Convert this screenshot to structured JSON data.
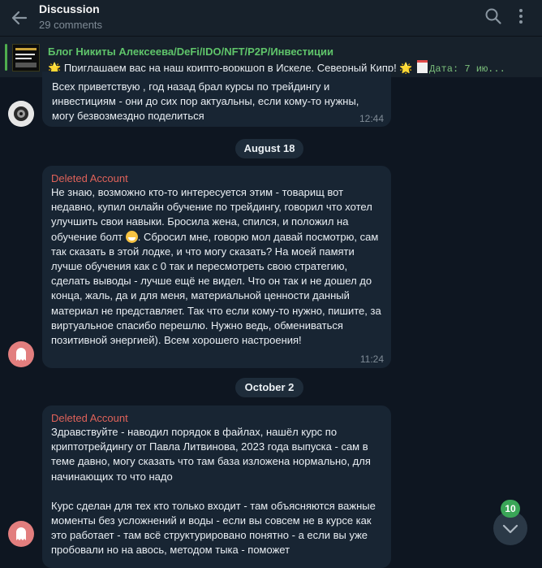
{
  "header": {
    "title": "Discussion",
    "subtitle": "29 comments"
  },
  "pinned": {
    "channel": "Блог Никиты Алексеева/DeFi/IDO/NFT/P2P/Инвестиции",
    "star_left": "🌟",
    "text": "Приглашаем вас на наш крипто-воркшоп в Искеле, Северный Кипр!",
    "star_right": "🌟",
    "meta": "Дата: 7 ию..."
  },
  "messages": [
    {
      "text": "Всех приветствую , год назад брал курсы по трейдингу и инвестициям - они до сих пор актуальны, если кому-то нужны, могу безвозмездно поделиться",
      "time": "12:44"
    },
    {
      "date": "August 18",
      "sender": "Deleted Account",
      "text_before": "Не знаю, возможно кто-то интересуется этим - товарищ вот недавно, купил онлайн обучение по трейдингу, говорил что хотел улучшить свои навыки. Бросила жена, спился, и положил на обучение болт",
      "emoji": "grinning-face",
      "text_after": ". Сбросил мне, говорю мол давай посмотрю, сам так сказать в этой лодке, и что могу сказать? На моей памяти лучше обучения как с 0 так и пересмотреть свою стратегию, сделать выводы - лучше ещё не видел. Что он так и не дошел до конца, жаль, да и для меня, материальной ценности данный материал не представляет. Так что если кому-то нужно, пишите, за виртуальное спасибо перешлю. Нужно ведь, обмениваться позитивной энергией). Всем хорошего настроения!",
      "time": "11:24"
    },
    {
      "date": "October 2",
      "sender": "Deleted Account",
      "paragraph1": "Здравствуйте - наводил порядок в файлах, нашёл курс по криптотрейдингу от Павла Литвинова, 2023 года выпуска - сам в теме давно, могу сказать что там база изложена нормально, для начинающих то что надо",
      "paragraph2": "Курс сделан для тех кто только входит - там объясняются важные моменты без усложнений и воды - если вы совсем не в курсе как это работает - там всё структурировано понятно - а если вы уже пробовали но на авось, методом тыка - поможет"
    }
  ],
  "scroll": {
    "unread_count": "10"
  },
  "colors": {
    "background": "#0e1621",
    "bubble": "#182533",
    "sender_name": "#e0625a",
    "pinned_channel": "#5fc46a",
    "badge": "#3aa557"
  }
}
